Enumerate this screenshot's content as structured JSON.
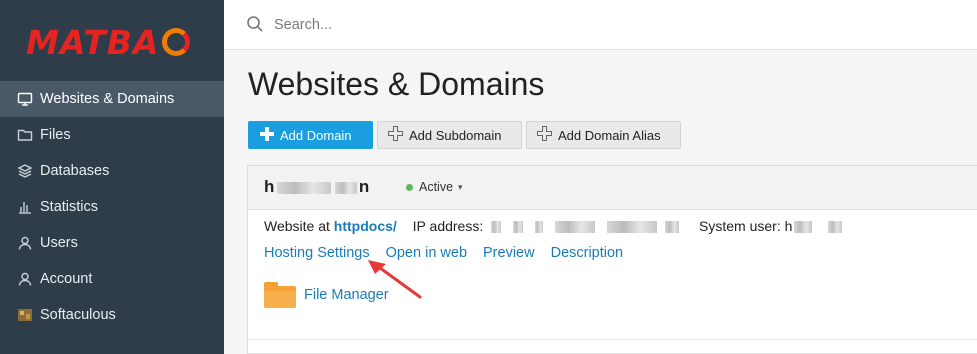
{
  "brand": {
    "logo_text": "MATBAO",
    "logo_letters": "MATBA"
  },
  "sidebar": {
    "items": [
      {
        "label": "Websites & Domains",
        "icon": "monitor-icon",
        "active": true
      },
      {
        "label": "Files",
        "icon": "folder-icon"
      },
      {
        "label": "Databases",
        "icon": "database-icon"
      },
      {
        "label": "Statistics",
        "icon": "bar-chart-icon"
      },
      {
        "label": "Users",
        "icon": "user-icon"
      },
      {
        "label": "Account",
        "icon": "account-icon"
      },
      {
        "label": "Softaculous",
        "icon": "softaculous-icon"
      }
    ]
  },
  "search": {
    "placeholder": "Search..."
  },
  "page": {
    "title": "Websites & Domains"
  },
  "toolbar": {
    "add_domain": "Add Domain",
    "add_subdomain": "Add Subdomain",
    "add_domain_alias": "Add Domain Alias"
  },
  "domain": {
    "name_start": "h",
    "name_end": "n",
    "status": "Active",
    "website_at_label": "Website at",
    "website_at_value": "httpdocs/",
    "ip_label": "IP address:",
    "system_user_label": "System user:",
    "system_user_start": "h",
    "links": [
      "Hosting Settings",
      "Open in web",
      "Preview",
      "Description"
    ],
    "file_manager": "File Manager"
  },
  "colors": {
    "sidebar_bg": "#2f3d4b",
    "accent": "#1a9ee0",
    "link": "#1a7db8",
    "brand_red": "#e52421",
    "annotation_arrow": "#e53935"
  }
}
